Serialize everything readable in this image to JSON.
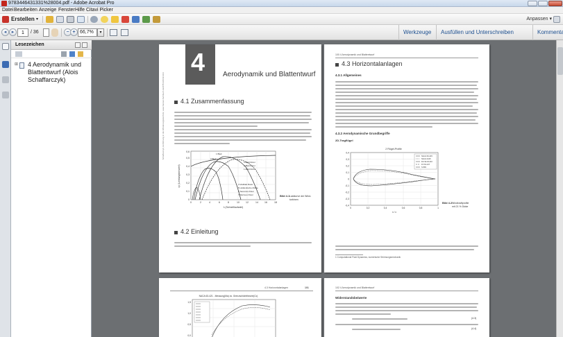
{
  "window": {
    "title": "9783446431331%28004.pdf - Adobe Acrobat Pro"
  },
  "menu": [
    "Datei",
    "Bearbeiten",
    "Anzeige",
    "Fenster",
    "Hilfe",
    "Citavi Picker"
  ],
  "toolbar1": {
    "create_label": "Erstellen",
    "customize_label": "Anpassen"
  },
  "nav": {
    "current_page": "1",
    "total_pages": "/ 36",
    "zoom": "66,7%"
  },
  "right_tabs": [
    "Werkzeuge",
    "Ausfüllen und Unterschreiben",
    "Kommentar"
  ],
  "bookmarks": {
    "title": "Lesezeichen",
    "item": "4 Aerodynamik und Blattentwurf (Alois Schaffarczyk)"
  },
  "page1": {
    "chapter_number": "4",
    "chapter_title": "Aerodynamik und Blattentwurf",
    "sec41": "4.1  Zusammenfassung",
    "sec42": "4.2  Einleitung",
    "figure_caption_bold": "Bild 4.1",
    "figure_caption": "Lastkurve der Wind-",
    "figure_caption2": "turbinen",
    "xlabel": "λ (Schnelllaufzahl)",
    "ylabel": "cp (Leistungsbeiwert)",
    "legend_top": [
      "1 Blatt",
      "2 Blatt",
      "3 Blatt",
      "Grenze"
    ],
    "legend_right": [
      "3-Blatt Rotor",
      "2-Blatt Rotor",
      "1-Blatt Rotor"
    ],
    "legend_bottom": [
      "4 Vielblatt Rotor",
      "5 Holländische Mühle",
      "6 Savonius Rotor",
      "7 Darrieus Rotor"
    ],
    "x_ticks": [
      "0",
      "2",
      "4",
      "6",
      "8",
      "10",
      "12",
      "14",
      "16",
      "18"
    ],
    "y_ticks": [
      "0",
      "0,1",
      "0,2",
      "0,3",
      "0,4",
      "0,5",
      "0,6"
    ],
    "side_text": "Schaffarczyk, Einführung in die Windenergietechnik, www.hanser-fachbuch.de/9783446431331"
  },
  "page2": {
    "header": "100   4 Aerodynamik und Blattentwurf",
    "sec43": "4.3  Horizontalanlagen",
    "sub431": "4.3.1  Allgemeines",
    "sub432": "4.3.2  Aerodynamische Grundbegriffe",
    "sub2d": "2D-Tragflügel",
    "chart_title": "2 Flügel-Profile",
    "chart_legend": [
      "NACA 63-415",
      "NACA 4415",
      "DU 93-W-210",
      "FX 63-137",
      "S 809"
    ],
    "x_ticks": [
      "0",
      "0,2",
      "0,4",
      "0,6",
      "0,8",
      "1"
    ],
    "y_ticks": [
      "0,4",
      "0,3",
      "0,2",
      "0,1",
      "0",
      "-0,1",
      "-0,2",
      "-0,3",
      "-0,4"
    ],
    "xlabel": "x / c",
    "caption_bold": "Bild 4.2",
    "caption": "Windkraftprofile",
    "caption2": "mit 21 % Dicke",
    "footnote": "1  Computational Fluid Dynamics, numerische Strömungsmechanik"
  },
  "page3": {
    "header": "4.3  Horizontalanlagen",
    "page_number": "101",
    "chart_title": "NACA 63-421 - Messung(Ma) vs. Grenzschichttheorie(Cc)",
    "y_ticks": [
      "1,5",
      "1,0",
      "0,5",
      "0,0"
    ]
  },
  "page4": {
    "header": "102   4 Aerodynamik und Blattentwurf",
    "subhead": "Widerstandsbeiwerte",
    "eq1": "(4.3)",
    "eq2": "(4.4)"
  }
}
